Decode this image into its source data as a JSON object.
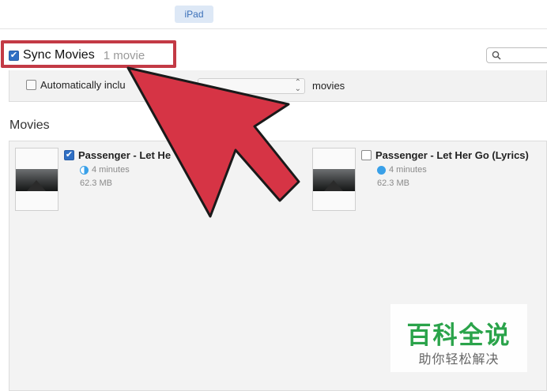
{
  "header": {
    "device_tab": "iPad"
  },
  "sync": {
    "label": "Sync Movies",
    "count": "1 movie",
    "checked": true,
    "highlight_color": "#c33a45"
  },
  "search": {
    "placeholder": "",
    "icon": "search-icon"
  },
  "auto_include": {
    "label": "Automatically inclu",
    "checked": false,
    "select_value": "",
    "suffix": "movies"
  },
  "movies_section": {
    "title": "Movies",
    "items": [
      {
        "title": "Passenger - Let He",
        "duration": "4 minutes",
        "size": "62.3 MB",
        "checked": true,
        "status_icon": "half-pie-icon"
      },
      {
        "title": "Passenger - Let Her Go (Lyrics)",
        "duration": "4 minutes",
        "size": "62.3 MB",
        "checked": false,
        "status_icon": "full-pie-icon"
      }
    ]
  },
  "annotation": {
    "arrow_color": "#d63445",
    "arrow_outline": "#1a1a1a"
  },
  "watermark": {
    "main": "百科全说",
    "sub": "助你轻松解决",
    "color": "#2aa34a"
  }
}
